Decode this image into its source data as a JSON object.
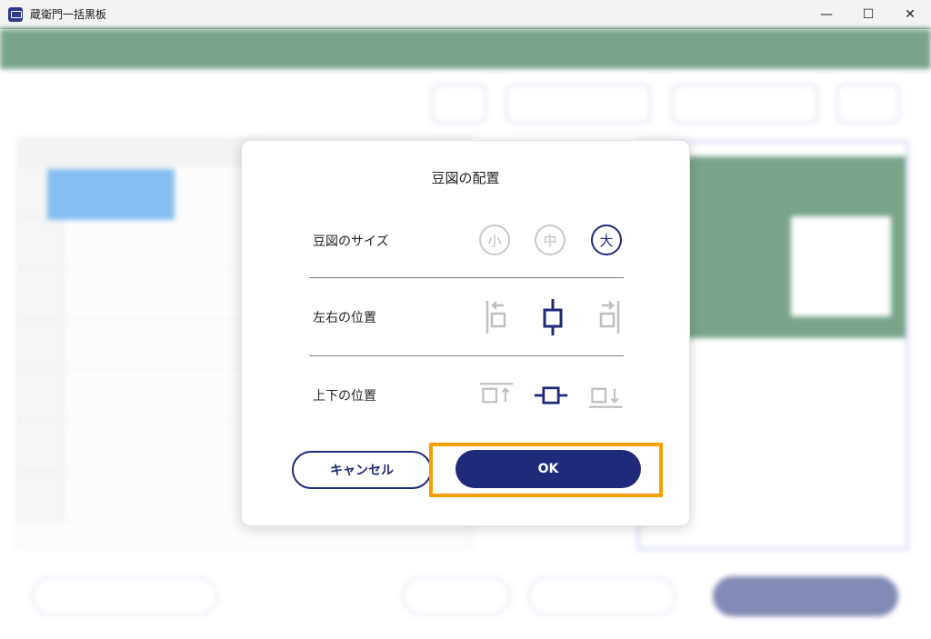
{
  "window": {
    "title": "蔵衛門一括黒板",
    "minimize_glyph": "—",
    "maximize_glyph": "☐",
    "close_glyph": "✕"
  },
  "dialog": {
    "title": "豆図の配置",
    "size_row": {
      "label": "豆図のサイズ",
      "options": [
        "小",
        "中",
        "大"
      ],
      "selected": "大"
    },
    "horizontal_row": {
      "label": "左右の位置",
      "options": [
        "left-align-icon",
        "center-horizontal-icon",
        "right-align-icon"
      ],
      "selected": "center-horizontal-icon"
    },
    "vertical_row": {
      "label": "上下の位置",
      "options": [
        "top-align-icon",
        "center-vertical-icon",
        "bottom-align-icon"
      ],
      "selected": "center-vertical-icon"
    },
    "cancel_label": "キャンセル",
    "ok_label": "OK"
  },
  "colors": {
    "brand_navy": "#1f2a7a",
    "header_green": "#0d5a2e",
    "highlight_orange": "#f5a000",
    "inactive_gray": "#c8c8c8"
  }
}
